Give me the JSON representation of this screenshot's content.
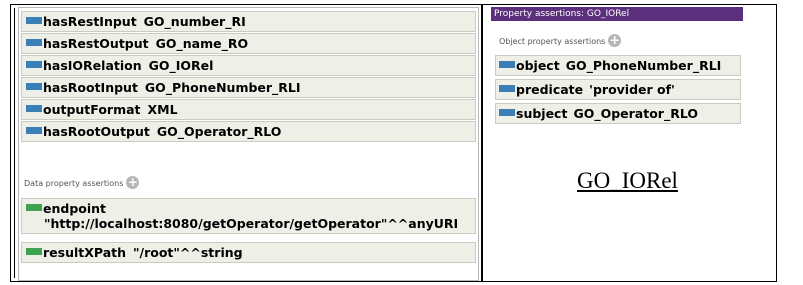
{
  "left_panel": {
    "object_rows": [
      {
        "property": "hasRestInput",
        "value": "GO_number_RI"
      },
      {
        "property": "hasRestOutput",
        "value": "GO_name_RO"
      },
      {
        "property": "hasIORelation",
        "value": "GO_IORel"
      },
      {
        "property": "hasRootInput",
        "value": "GO_PhoneNumber_RLI"
      },
      {
        "property": "outputFormat",
        "value": "XML"
      },
      {
        "property": "hasRootOutput",
        "value": "GO_Operator_RLO"
      }
    ],
    "data_header": "Data property assertions",
    "data_rows": [
      {
        "property": "endpoint",
        "value": "\"http://localhost:8080/getOperator/getOperator\"^^anyURI"
      },
      {
        "property": "resultXPath",
        "value": "\"/root\"^^string"
      }
    ]
  },
  "right_panel": {
    "title": "Property assertions: GO_IORel",
    "object_header": "Object property assertions",
    "rows": [
      {
        "property": "object",
        "value": "GO_PhoneNumber_RLI"
      },
      {
        "property": "predicate",
        "value": "'provider of'"
      },
      {
        "property": "subject",
        "value": "GO_Operator_RLO"
      }
    ]
  },
  "caption": "GO_IORel",
  "colors": {
    "object_bar": "#3b7fb8",
    "data_bar": "#3da350",
    "title_bar": "#5b2f7c",
    "row_bg": "#eef0e8"
  },
  "icons": {
    "object_property": "blue-bar-icon",
    "data_property": "green-bar-icon",
    "add": "plus-circle-icon"
  }
}
